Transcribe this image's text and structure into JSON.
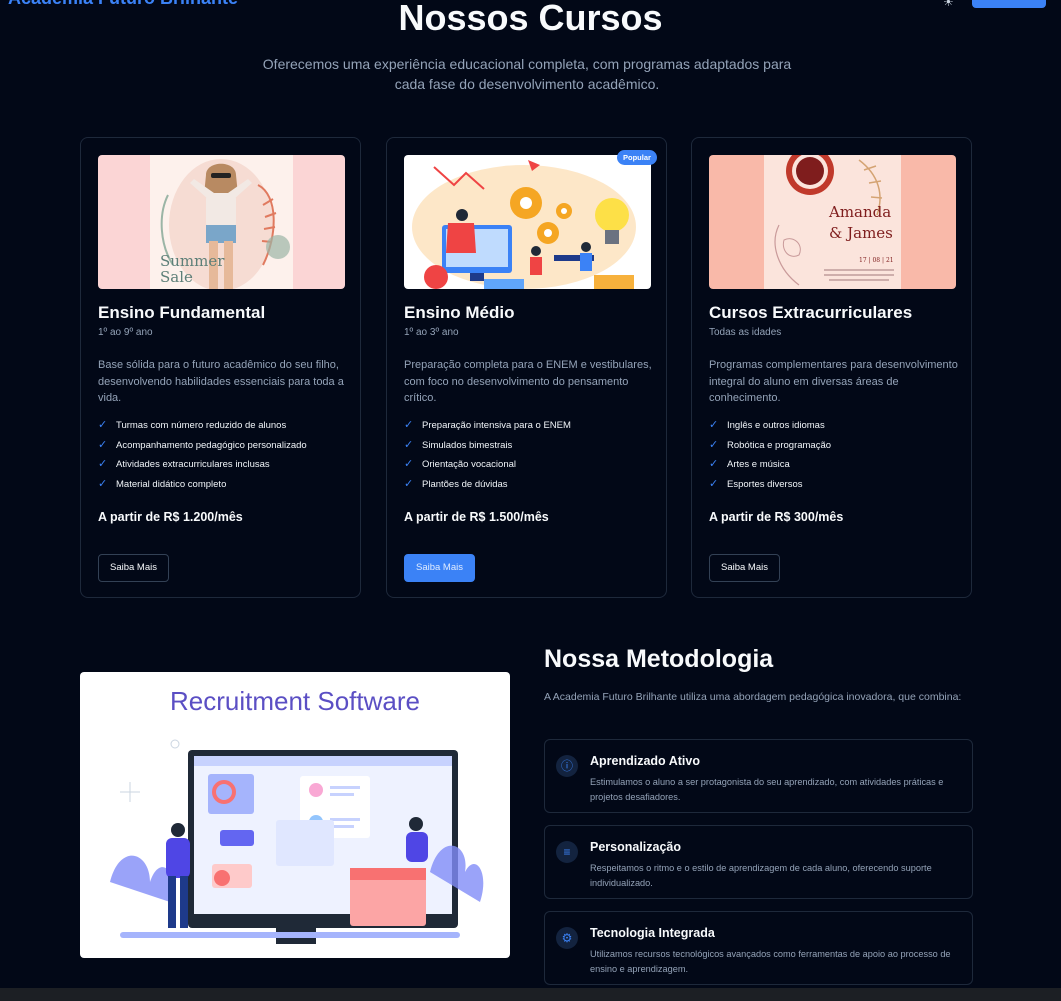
{
  "header": {
    "brand": "Academia Futuro Brilhante"
  },
  "section": {
    "title": "Nossos Cursos",
    "subtitle": "Oferecemos uma experiência educacional completa, com programas adaptados para cada fase do desenvolvimento acadêmico."
  },
  "courses": [
    {
      "title": "Ensino Fundamental",
      "age": "1º ao 9º ano",
      "description": "Base sólida para o futuro acadêmico do seu filho, desenvolvendo habilidades essenciais para toda a vida.",
      "features": [
        "Turmas com número reduzido de alunos",
        "Acompanhamento pedagógico personalizado",
        "Atividades extracurriculares inclusas",
        "Material didático completo"
      ],
      "price": "A partir de R$ 1.200/mês",
      "button": "Saiba Mais",
      "image_text": [
        "Summer",
        "Sale"
      ]
    },
    {
      "title": "Ensino Médio",
      "age": "1º ao 3º ano",
      "description": "Preparação completa para o ENEM e vestibulares, com foco no desenvolvimento do pensamento crítico.",
      "features": [
        "Preparação intensiva para o ENEM",
        "Simulados bimestrais",
        "Orientação vocacional",
        "Plantões de dúvidas"
      ],
      "price": "A partir de R$ 1.500/mês",
      "button": "Saiba Mais",
      "badge": "Popular"
    },
    {
      "title": "Cursos Extracurriculares",
      "age": "Todas as idades",
      "description": "Programas complementares para desenvolvimento integral do aluno em diversas áreas de conhecimento.",
      "features": [
        "Inglês e outros idiomas",
        "Robótica e programação",
        "Artes e música",
        "Esportes diversos"
      ],
      "price": "A partir de R$ 300/mês",
      "button": "Saiba Mais",
      "image_text": [
        "Amanda",
        "& James",
        "17 | 08 | 21"
      ]
    }
  ],
  "methodology": {
    "title": "Nossa Metodologia",
    "intro": "A Academia Futuro Brilhante utiliza uma abordagem pedagógica inovadora, que combina:",
    "image_title": "Recruitment Software",
    "items": [
      {
        "icon": "info-icon",
        "title": "Aprendizado Ativo",
        "text": "Estimulamos o aluno a ser protagonista do seu aprendizado, com atividades práticas e projetos desafiadores."
      },
      {
        "icon": "list-icon",
        "title": "Personalização",
        "text": "Respeitamos o ritmo e o estilo de aprendizagem de cada aluno, oferecendo suporte individualizado."
      },
      {
        "icon": "gear-icon",
        "title": "Tecnologia Integrada",
        "text": "Utilizamos recursos tecnológicos avançados como ferramentas de apoio ao processo de ensino e aprendizagem."
      }
    ]
  },
  "colors": {
    "background": "#020817",
    "accent": "#3b82f6",
    "muted": "#94a3b8",
    "border": "#1e293b"
  }
}
